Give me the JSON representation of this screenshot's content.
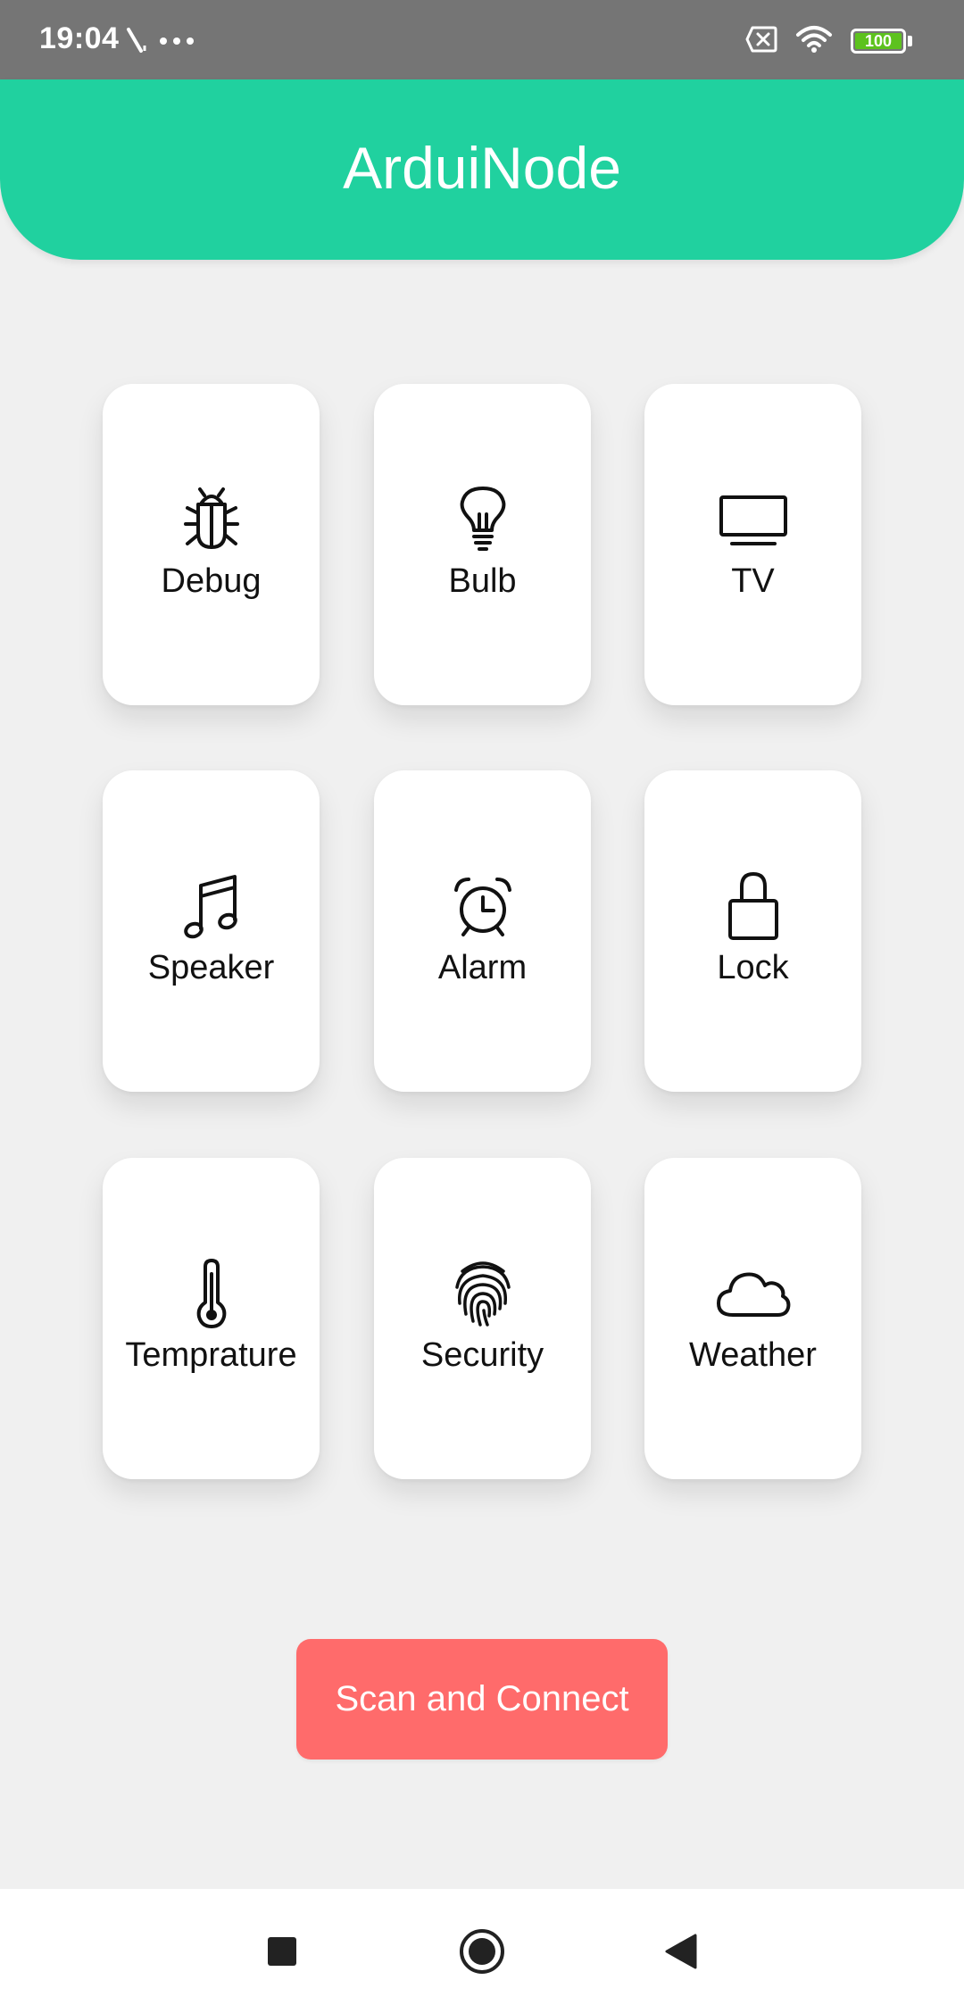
{
  "status_bar": {
    "time": "19:04",
    "battery_level": "100",
    "battery_color": "#5dc21e",
    "icons": [
      "signal-slash-icon",
      "more-dots-icon",
      "sim-off-icon",
      "wifi-icon",
      "battery-icon"
    ]
  },
  "header": {
    "title": "ArduiNode",
    "color": "#20d19f"
  },
  "tiles": [
    {
      "label": "Debug",
      "icon": "bug-icon"
    },
    {
      "label": "Bulb",
      "icon": "lightbulb-icon"
    },
    {
      "label": "TV",
      "icon": "tv-icon"
    },
    {
      "label": "Speaker",
      "icon": "music-note-icon"
    },
    {
      "label": "Alarm",
      "icon": "alarm-clock-icon"
    },
    {
      "label": "Lock",
      "icon": "lock-icon"
    },
    {
      "label": "Temprature",
      "icon": "thermometer-icon"
    },
    {
      "label": "Security",
      "icon": "fingerprint-icon"
    },
    {
      "label": "Weather",
      "icon": "cloud-icon"
    }
  ],
  "scan_button": {
    "label": "Scan and Connect",
    "color": "#ff6b6b"
  },
  "nav_bar": {
    "icons": [
      "recents-square-icon",
      "home-circle-icon",
      "back-triangle-icon"
    ]
  }
}
